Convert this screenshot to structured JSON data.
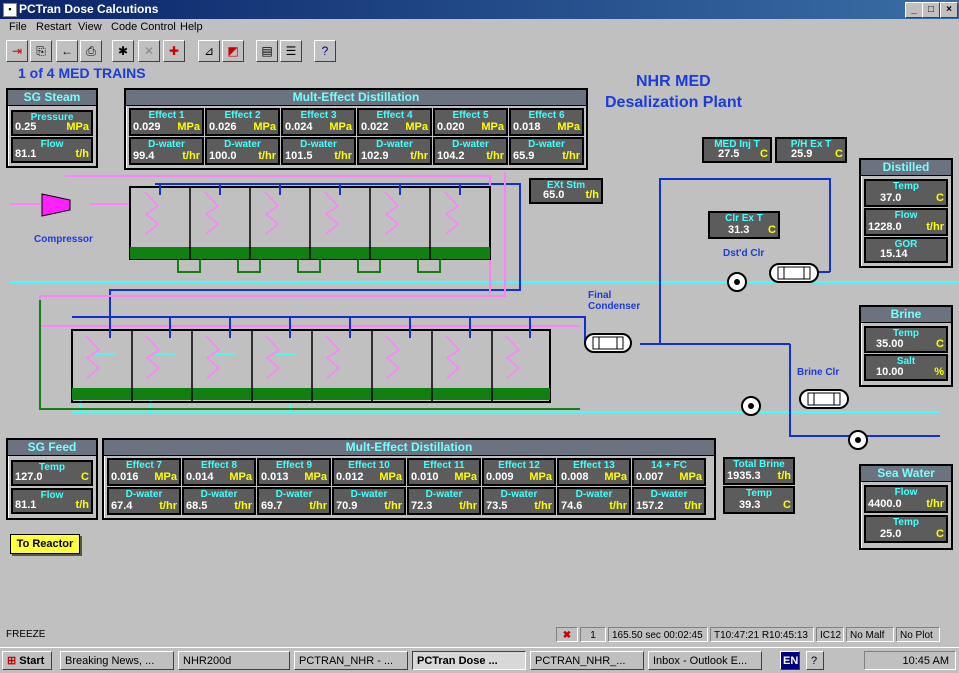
{
  "window": {
    "title": "PCTran Dose Calcutions"
  },
  "menu": [
    "File",
    "Restart",
    "View",
    "Code Control",
    "Help"
  ],
  "heading": {
    "trains": "1 of 4 MED TRAINS",
    "plant_line1": "NHR MED",
    "plant_line2": "Desalization Plant"
  },
  "sg_steam": {
    "title": "SG Steam",
    "pressure": {
      "label": "Pressure",
      "value": "0.25",
      "unit": "MPa"
    },
    "flow": {
      "label": "Flow",
      "value": "81.1",
      "unit": "t/h"
    }
  },
  "med_top": {
    "title": "Mult-Effect Distillation",
    "effects": [
      {
        "label": "Effect 1",
        "p": "0.029",
        "pu": "MPa",
        "dw": "99.4",
        "du": "t/hr"
      },
      {
        "label": "Effect 2",
        "p": "0.026",
        "pu": "MPa",
        "dw": "100.0",
        "du": "t/hr"
      },
      {
        "label": "Effect 3",
        "p": "0.024",
        "pu": "MPa",
        "dw": "101.5",
        "du": "t/hr"
      },
      {
        "label": "Effect 4",
        "p": "0.022",
        "pu": "MPa",
        "dw": "102.9",
        "du": "t/hr"
      },
      {
        "label": "Effect 5",
        "p": "0.020",
        "pu": "MPa",
        "dw": "104.2",
        "du": "t/hr"
      },
      {
        "label": "Effect 6",
        "p": "0.018",
        "pu": "MPa",
        "dw": "65.9",
        "du": "t/hr"
      }
    ],
    "dw_label": "D-water"
  },
  "med_inj": {
    "label": "MED Inj T",
    "value": "27.5",
    "unit": "C"
  },
  "ph_ex": {
    "label": "P/H Ex T",
    "value": "25.9",
    "unit": "C"
  },
  "ext_stm": {
    "label": "EXt Stm",
    "value": "65.0",
    "unit": "t/h"
  },
  "clr_ex": {
    "label": "Clr Ex T",
    "value": "31.3",
    "unit": "C"
  },
  "distilled": {
    "title": "Distilled",
    "temp": {
      "label": "Temp",
      "value": "37.0",
      "unit": "C"
    },
    "flow": {
      "label": "Flow",
      "value": "1228.0",
      "unit": "t/hr"
    },
    "gor": {
      "label": "GOR",
      "value": "15.14",
      "unit": ""
    }
  },
  "brine": {
    "title": "Brine",
    "temp": {
      "label": "Temp",
      "value": "35.00",
      "unit": "C"
    },
    "salt": {
      "label": "Salt",
      "value": "10.00",
      "unit": "%"
    }
  },
  "sea_water": {
    "title": "Sea Water",
    "flow": {
      "label": "Flow",
      "value": "4400.0",
      "unit": "t/hr"
    },
    "temp": {
      "label": "Temp",
      "value": "25.0",
      "unit": "C"
    }
  },
  "sg_feed": {
    "title": "SG Feed",
    "temp": {
      "label": "Temp",
      "value": "127.0",
      "unit": "C"
    },
    "flow": {
      "label": "Flow",
      "value": "81.1",
      "unit": "t/h"
    }
  },
  "med_bottom": {
    "title": "Mult-Effect Distillation",
    "effects": [
      {
        "label": "Effect 7",
        "p": "0.016",
        "pu": "MPa",
        "dw": "67.4",
        "du": "t/hr"
      },
      {
        "label": "Effect 8",
        "p": "0.014",
        "pu": "MPa",
        "dw": "68.5",
        "du": "t/hr"
      },
      {
        "label": "Effect 9",
        "p": "0.013",
        "pu": "MPa",
        "dw": "69.7",
        "du": "t/hr"
      },
      {
        "label": "Effect 10",
        "p": "0.012",
        "pu": "MPa",
        "dw": "70.9",
        "du": "t/hr"
      },
      {
        "label": "Effect 11",
        "p": "0.010",
        "pu": "MPa",
        "dw": "72.3",
        "du": "t/hr"
      },
      {
        "label": "Effect 12",
        "p": "0.009",
        "pu": "MPa",
        "dw": "73.5",
        "du": "t/hr"
      },
      {
        "label": "Effect 13",
        "p": "0.008",
        "pu": "MPa",
        "dw": "74.6",
        "du": "t/hr"
      },
      {
        "label": "14 + FC",
        "p": "0.007",
        "pu": "MPa",
        "dw": "157.2",
        "du": "t/hr"
      }
    ],
    "dw_label": "D-water"
  },
  "total_brine": {
    "label": "Total Brine",
    "value": "1935.3",
    "unit": "t/h",
    "temp": {
      "label": "Temp",
      "value": "39.3",
      "unit": "C"
    }
  },
  "diagram": {
    "compressor": "Compressor",
    "final_condenser_1": "Final",
    "final_condenser_2": "Condenser",
    "dstd_clr": "Dst'd Clr",
    "brine_clr": "Brine Clr"
  },
  "to_reactor": "To Reactor",
  "status": {
    "mode": "FREEZE",
    "speed": "1",
    "time": "165.50 sec  00:02:45",
    "clock": "T10:47:21 R10:45:13",
    "ic": "IC12",
    "malf": "No Malf",
    "plot": "No Plot"
  },
  "taskbar": {
    "start": "Start",
    "tasks": [
      "Breaking News, ...",
      "NHR200d",
      "PCTRAN_NHR - ...",
      "PCTran Dose ...",
      "PCTRAN_NHR_...",
      "Inbox - Outlook E..."
    ],
    "lang": "EN",
    "time": "10:45 AM"
  },
  "colors": {
    "pipe_blue": "#1030d0",
    "pipe_cyan": "#40ffff",
    "pipe_pink": "#ff80ff",
    "pipe_green": "#108010",
    "panel_header": "#6b7380"
  }
}
